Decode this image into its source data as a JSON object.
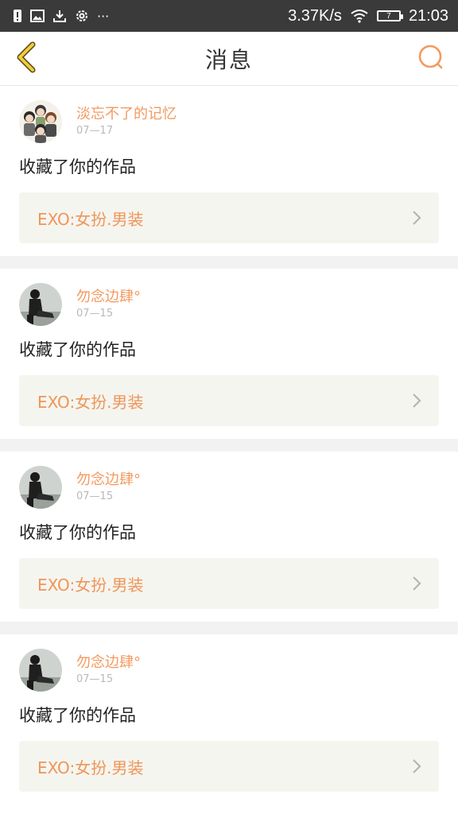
{
  "statusbar": {
    "speed": "3.37K/s",
    "battery": "7",
    "time": "21:03",
    "more": "···"
  },
  "navbar": {
    "title": "消息"
  },
  "colors": {
    "accent": "#f39a60",
    "back_icon": "#f1cc3a",
    "card_bg": "#f5f5ef",
    "separator": "#f2f2f2"
  },
  "messages": [
    {
      "username": "淡忘不了的记忆",
      "date": "07—17",
      "action": "收藏了你的作品",
      "work_title": "EXO:女扮.男装",
      "avatar": "cartoon-group-avatar"
    },
    {
      "username": "勿念边肆°",
      "date": "07—15",
      "action": "收藏了你的作品",
      "work_title": "EXO:女扮.男装",
      "avatar": "dark-figure-avatar"
    },
    {
      "username": "勿念边肆°",
      "date": "07—15",
      "action": "收藏了你的作品",
      "work_title": "EXO:女扮.男装",
      "avatar": "dark-figure-avatar"
    },
    {
      "username": "勿念边肆°",
      "date": "07—15",
      "action": "收藏了你的作品",
      "work_title": "EXO:女扮.男装",
      "avatar": "dark-figure-avatar"
    }
  ]
}
